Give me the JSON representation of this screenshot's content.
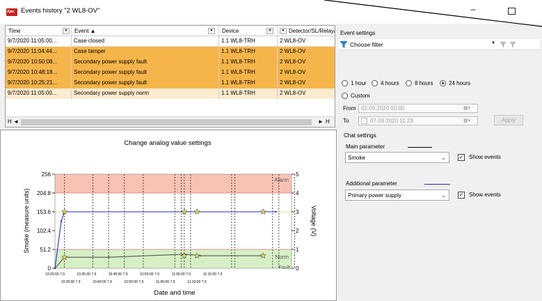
{
  "window": {
    "title": "Events history \"2 WL8-OV\"",
    "app_badge": "Ajax",
    "minimize_glyph": "–"
  },
  "table": {
    "columns": [
      "Time",
      "Event ▲",
      "Device",
      "Detector/SL/Relay/L"
    ],
    "rows": [
      {
        "time": "9/7/2020 11:05:00...",
        "event": "Case closed",
        "device": "1.1 WL8-TRH",
        "detector": "2 WL8-OV",
        "style": "plain"
      },
      {
        "time": "9/7/2020 11:04:44...",
        "event": "Case tamper",
        "device": "1.1 WL8-TRH",
        "detector": "2 WL8-OV",
        "style": "orange"
      },
      {
        "time": "9/7/2020 10:50:08...",
        "event": "Secondary power supply fault",
        "device": "1.1 WL8-TRH",
        "detector": "2 WL8-OV",
        "style": "orange"
      },
      {
        "time": "9/7/2020 10:48:18...",
        "event": "Secondary power supply fault",
        "device": "1.1 WL8-TRH",
        "detector": "2 WL8-OV",
        "style": "orange"
      },
      {
        "time": "9/7/2020 10:25:21...",
        "event": "Secondary power supply fault",
        "device": "1.1 WL8-TRH",
        "detector": "2 WL8-OV",
        "style": "orange"
      },
      {
        "time": "9/7/2020 11:05:00...",
        "event": "Secondary power supply norm",
        "device": "1.1 WL8-TRH",
        "detector": "2 WL8-OV",
        "style": "light"
      }
    ],
    "scroll_left": "◄",
    "scroll_first": "H",
    "scroll_right": "►",
    "scroll_last": "H"
  },
  "event_settings": {
    "heading": "Event settings",
    "filter_placeholder": "Choose filter",
    "periods": [
      {
        "label": "1 hour",
        "selected": false
      },
      {
        "label": "4 hours",
        "selected": false
      },
      {
        "label": "8 hours",
        "selected": false
      },
      {
        "label": "24 hours",
        "selected": true
      }
    ],
    "custom_label": "Custom",
    "from_label": "From",
    "from_value": "02.09.2020 00:00",
    "to_label": "To",
    "to_value": "07.09.2020 11:23",
    "apply_label": "Apply"
  },
  "chat_settings": {
    "heading": "Chat settings",
    "main_label": "Main parameter",
    "main_value": "Smoke",
    "main_line_color": "#000000",
    "additional_label": "Additional parameter",
    "additional_value": "Primary power supply",
    "additional_line_color": "#1f2bd6",
    "show_events_label": "Show events",
    "show_events_main": true,
    "show_events_additional": true
  },
  "chart_data": {
    "type": "line",
    "title": "Change analog value settings",
    "xlabel": "Date and time",
    "ylabel": "Smoke (measure units)",
    "y2label": "Voltage (V)",
    "ylim": [
      0,
      256
    ],
    "y_ticks": [
      "0",
      "51.2",
      "102.4",
      "153.6",
      "204.8",
      "256"
    ],
    "y2lim": [
      0,
      5
    ],
    "y2_ticks": [
      "0",
      "1",
      "2",
      "3",
      "4",
      "5"
    ],
    "x_ticks_top": [
      "10:25:00 7.9",
      "10:35:00 7.9",
      "10:45:00 7.9",
      "10:55:00 7.9",
      "11:05:00 7.9",
      "11:15:00 7.9"
    ],
    "x_ticks_bottom": [
      "10:30:00 7.9",
      "10:40:00 7.9",
      "10:50:00 7.9",
      "11:00:00 7.9",
      "11:10:00 7.9"
    ],
    "zones": [
      {
        "label": "Alarm",
        "from": 204.8,
        "to": 256,
        "color": "#f8c3b4"
      },
      {
        "label": "Norm",
        "from": 0,
        "to": 51.2,
        "color": "#d6f0c6"
      }
    ],
    "fault_label": "Fault",
    "event_times_min": [
      3,
      12,
      17,
      22,
      28,
      38,
      40,
      41,
      43,
      56,
      57,
      69,
      71,
      76
    ],
    "series": [
      {
        "name": "Smoke",
        "axis": "left",
        "color": "#555555",
        "x_min": [
          0,
          3,
          17,
          41,
          45,
          46,
          66
        ],
        "y": [
          0,
          30,
          30,
          38,
          36,
          34,
          34
        ]
      },
      {
        "name": "Primary power supply",
        "axis": "right",
        "color": "#1f2bd6",
        "x_min": [
          0,
          2,
          3,
          70
        ],
        "y": [
          0,
          2.5,
          3.0,
          3.0
        ]
      }
    ],
    "event_markers": [
      {
        "x_min": 3,
        "series": "Smoke"
      },
      {
        "x_min": 3,
        "series": "Primary power supply"
      },
      {
        "x_min": 41,
        "series": "Primary power supply"
      },
      {
        "x_min": 45,
        "series": "Primary power supply"
      },
      {
        "x_min": 41,
        "series": "Smoke"
      },
      {
        "x_min": 45,
        "series": "Smoke"
      },
      {
        "x_min": 66,
        "series": "Smoke"
      },
      {
        "x_min": 66,
        "series": "Primary power supply"
      }
    ]
  }
}
